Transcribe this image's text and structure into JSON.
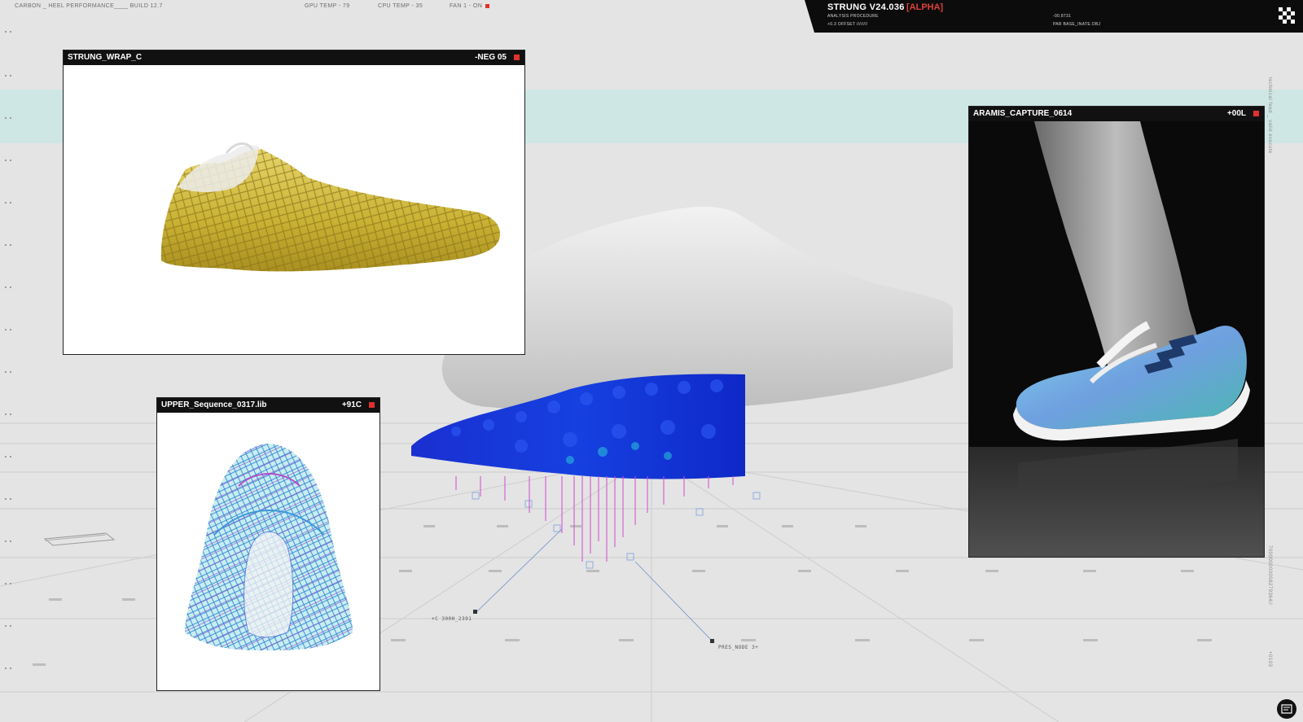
{
  "topbar": {
    "title": "CARBON _ HEEL PERFORMANCE____ BUILD 12.7",
    "gpu_temp": "GPU TEMP - 79",
    "cpu_temp": "CPU TEMP - 35",
    "fan": "FAN 1 - ON"
  },
  "hud": {
    "title": "STRUNG V24.036",
    "tag": "[ALPHA]",
    "line1": "ANALYSIS PROCEDURE",
    "line2": "+0.3 OFFSET ////////",
    "value": "-00.8731",
    "base": "PAR BASE_INATE.OBJ"
  },
  "side_label": "technical feed _ valid execute",
  "side_numbers": "700000000008279364//",
  "side_numbers2": "+0103",
  "panels": {
    "strung_wrap": {
      "title": "STRUNG_WRAP_C",
      "value": "-NEG 05"
    },
    "upper_sequence": {
      "title": "UPPER_Sequence_0317.lib",
      "value": "+91C"
    },
    "aramis_capture": {
      "title": "ARAMIS_CAPTURE_0614",
      "value": "+00L"
    }
  },
  "annotations": {
    "node_a": "+C 300H_2391",
    "node_b": "PRES_NODE 3+"
  },
  "colors": {
    "accent_red": "#e0312d",
    "sole_blue": "#1a2fd0",
    "band_cyan": "#cfe7e4",
    "hud_bg": "#0c0c0c"
  }
}
